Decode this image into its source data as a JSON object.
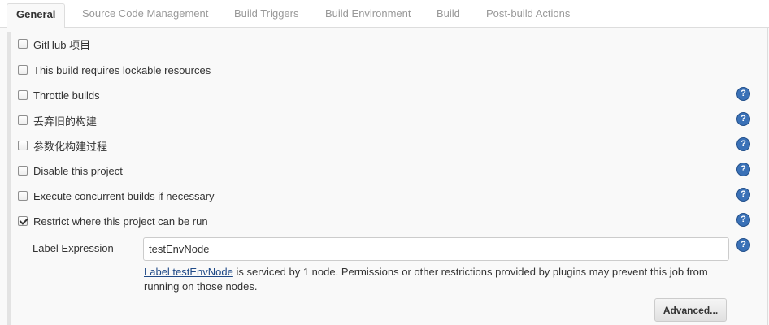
{
  "tabs": [
    {
      "label": "General",
      "active": true
    },
    {
      "label": "Source Code Management"
    },
    {
      "label": "Build Triggers"
    },
    {
      "label": "Build Environment"
    },
    {
      "label": "Build"
    },
    {
      "label": "Post-build Actions"
    }
  ],
  "options": [
    {
      "label": "GitHub 项目",
      "checked": false,
      "help": false
    },
    {
      "label": "This build requires lockable resources",
      "checked": false,
      "help": false
    },
    {
      "label": "Throttle builds",
      "checked": false,
      "help": true
    },
    {
      "label": "丢弃旧的构建",
      "checked": false,
      "help": true
    },
    {
      "label": "参数化构建过程",
      "checked": false,
      "help": true
    },
    {
      "label": "Disable this project",
      "checked": false,
      "help": true
    },
    {
      "label": "Execute concurrent builds if necessary",
      "checked": false,
      "help": true
    },
    {
      "label": "Restrict where this project can be run",
      "checked": true,
      "help": true
    }
  ],
  "help_glyph": "?",
  "label_expression": {
    "label": "Label Expression",
    "value": "testEnvNode",
    "info_link": "Label testEnvNode",
    "info_text": " is serviced by 1 node. Permissions or other restrictions provided by plugins may prevent this job from running on those nodes."
  },
  "advanced_button": "Advanced...",
  "colors": {
    "help_icon": "#3a71b7",
    "link": "#204a87",
    "panel_bg": "#f9f9f9"
  }
}
